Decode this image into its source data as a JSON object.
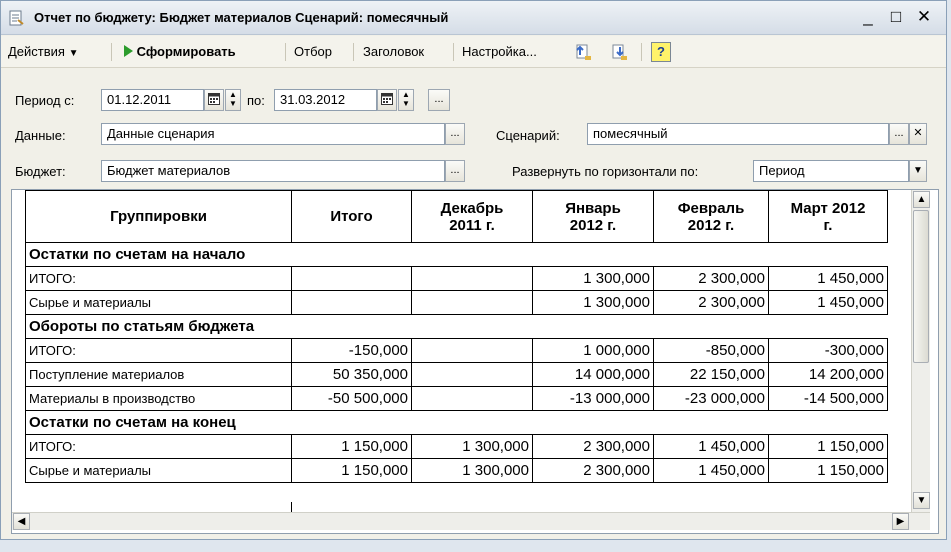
{
  "window": {
    "title": "Отчет по бюджету: Бюджет материалов Сценарий: помесячный",
    "minimize": "_",
    "maximize": "□",
    "close": "✕"
  },
  "toolbar": {
    "actions": "Действия",
    "generate": "Сформировать",
    "filter": "Отбор",
    "header": "Заголовок",
    "settings": "Настройка...",
    "help": "?"
  },
  "form": {
    "period_from_label": "Период с:",
    "period_from": "01.12.2011",
    "period_to_label": "по:",
    "period_to": "31.03.2012",
    "data_label": "Данные:",
    "data_value": "Данные сценария",
    "scenario_label": "Сценарий:",
    "scenario_value": "помесячный",
    "budget_label": "Бюджет:",
    "budget_value": "Бюджет материалов",
    "expand_label": "Развернуть по горизонтали по:",
    "expand_value": "Период",
    "select_btn": "...",
    "clear_btn": "✕"
  },
  "table": {
    "headers": [
      "Группировки",
      "Итого",
      "Декабрь 2011 г.",
      "Январь 2012 г.",
      "Февраль 2012 г.",
      "Март 2012 г."
    ],
    "header_lines": [
      [
        "Группировки"
      ],
      [
        "Итого"
      ],
      [
        "Декабрь",
        "2011 г."
      ],
      [
        "Январь",
        "2012 г."
      ],
      [
        "Февраль",
        "2012 г."
      ],
      [
        "Март 2012",
        "г."
      ]
    ],
    "rows": [
      {
        "kind": "group",
        "cells": [
          "Остатки по счетам на начало",
          "",
          "",
          "",
          "",
          ""
        ]
      },
      {
        "kind": "row",
        "cells": [
          "ИТОГО:",
          "",
          "",
          "1 300,000",
          "2 300,000",
          "1 450,000"
        ]
      },
      {
        "kind": "row",
        "cells": [
          "Сырье и материалы",
          "",
          "",
          "1 300,000",
          "2 300,000",
          "1 450,000"
        ]
      },
      {
        "kind": "group",
        "cells": [
          "Обороты по статьям бюджета",
          "",
          "",
          "",
          "",
          ""
        ]
      },
      {
        "kind": "row",
        "cells": [
          "ИТОГО:",
          "-150,000",
          "",
          "1 000,000",
          "-850,000",
          "-300,000"
        ]
      },
      {
        "kind": "row",
        "cells": [
          "Поступление материалов",
          "50 350,000",
          "",
          "14 000,000",
          "22 150,000",
          "14 200,000"
        ]
      },
      {
        "kind": "row",
        "cells": [
          "Материалы в производство",
          "-50 500,000",
          "",
          "-13 000,000",
          "-23 000,000",
          "-14 500,000"
        ]
      },
      {
        "kind": "group",
        "cells": [
          "Остатки по счетам на конец",
          "",
          "",
          "",
          "",
          ""
        ]
      },
      {
        "kind": "row",
        "cells": [
          "ИТОГО:",
          "1 150,000",
          "1 300,000",
          "2 300,000",
          "1 450,000",
          "1 150,000"
        ]
      },
      {
        "kind": "row",
        "cells": [
          "Сырье и материалы",
          "1 150,000",
          "1 300,000",
          "2 300,000",
          "1 450,000",
          "1 150,000"
        ]
      }
    ]
  },
  "colors": {
    "window_bg": "#f1f0e8",
    "play_green": "#2c9c2c",
    "help_yellow": "#fff36a"
  }
}
